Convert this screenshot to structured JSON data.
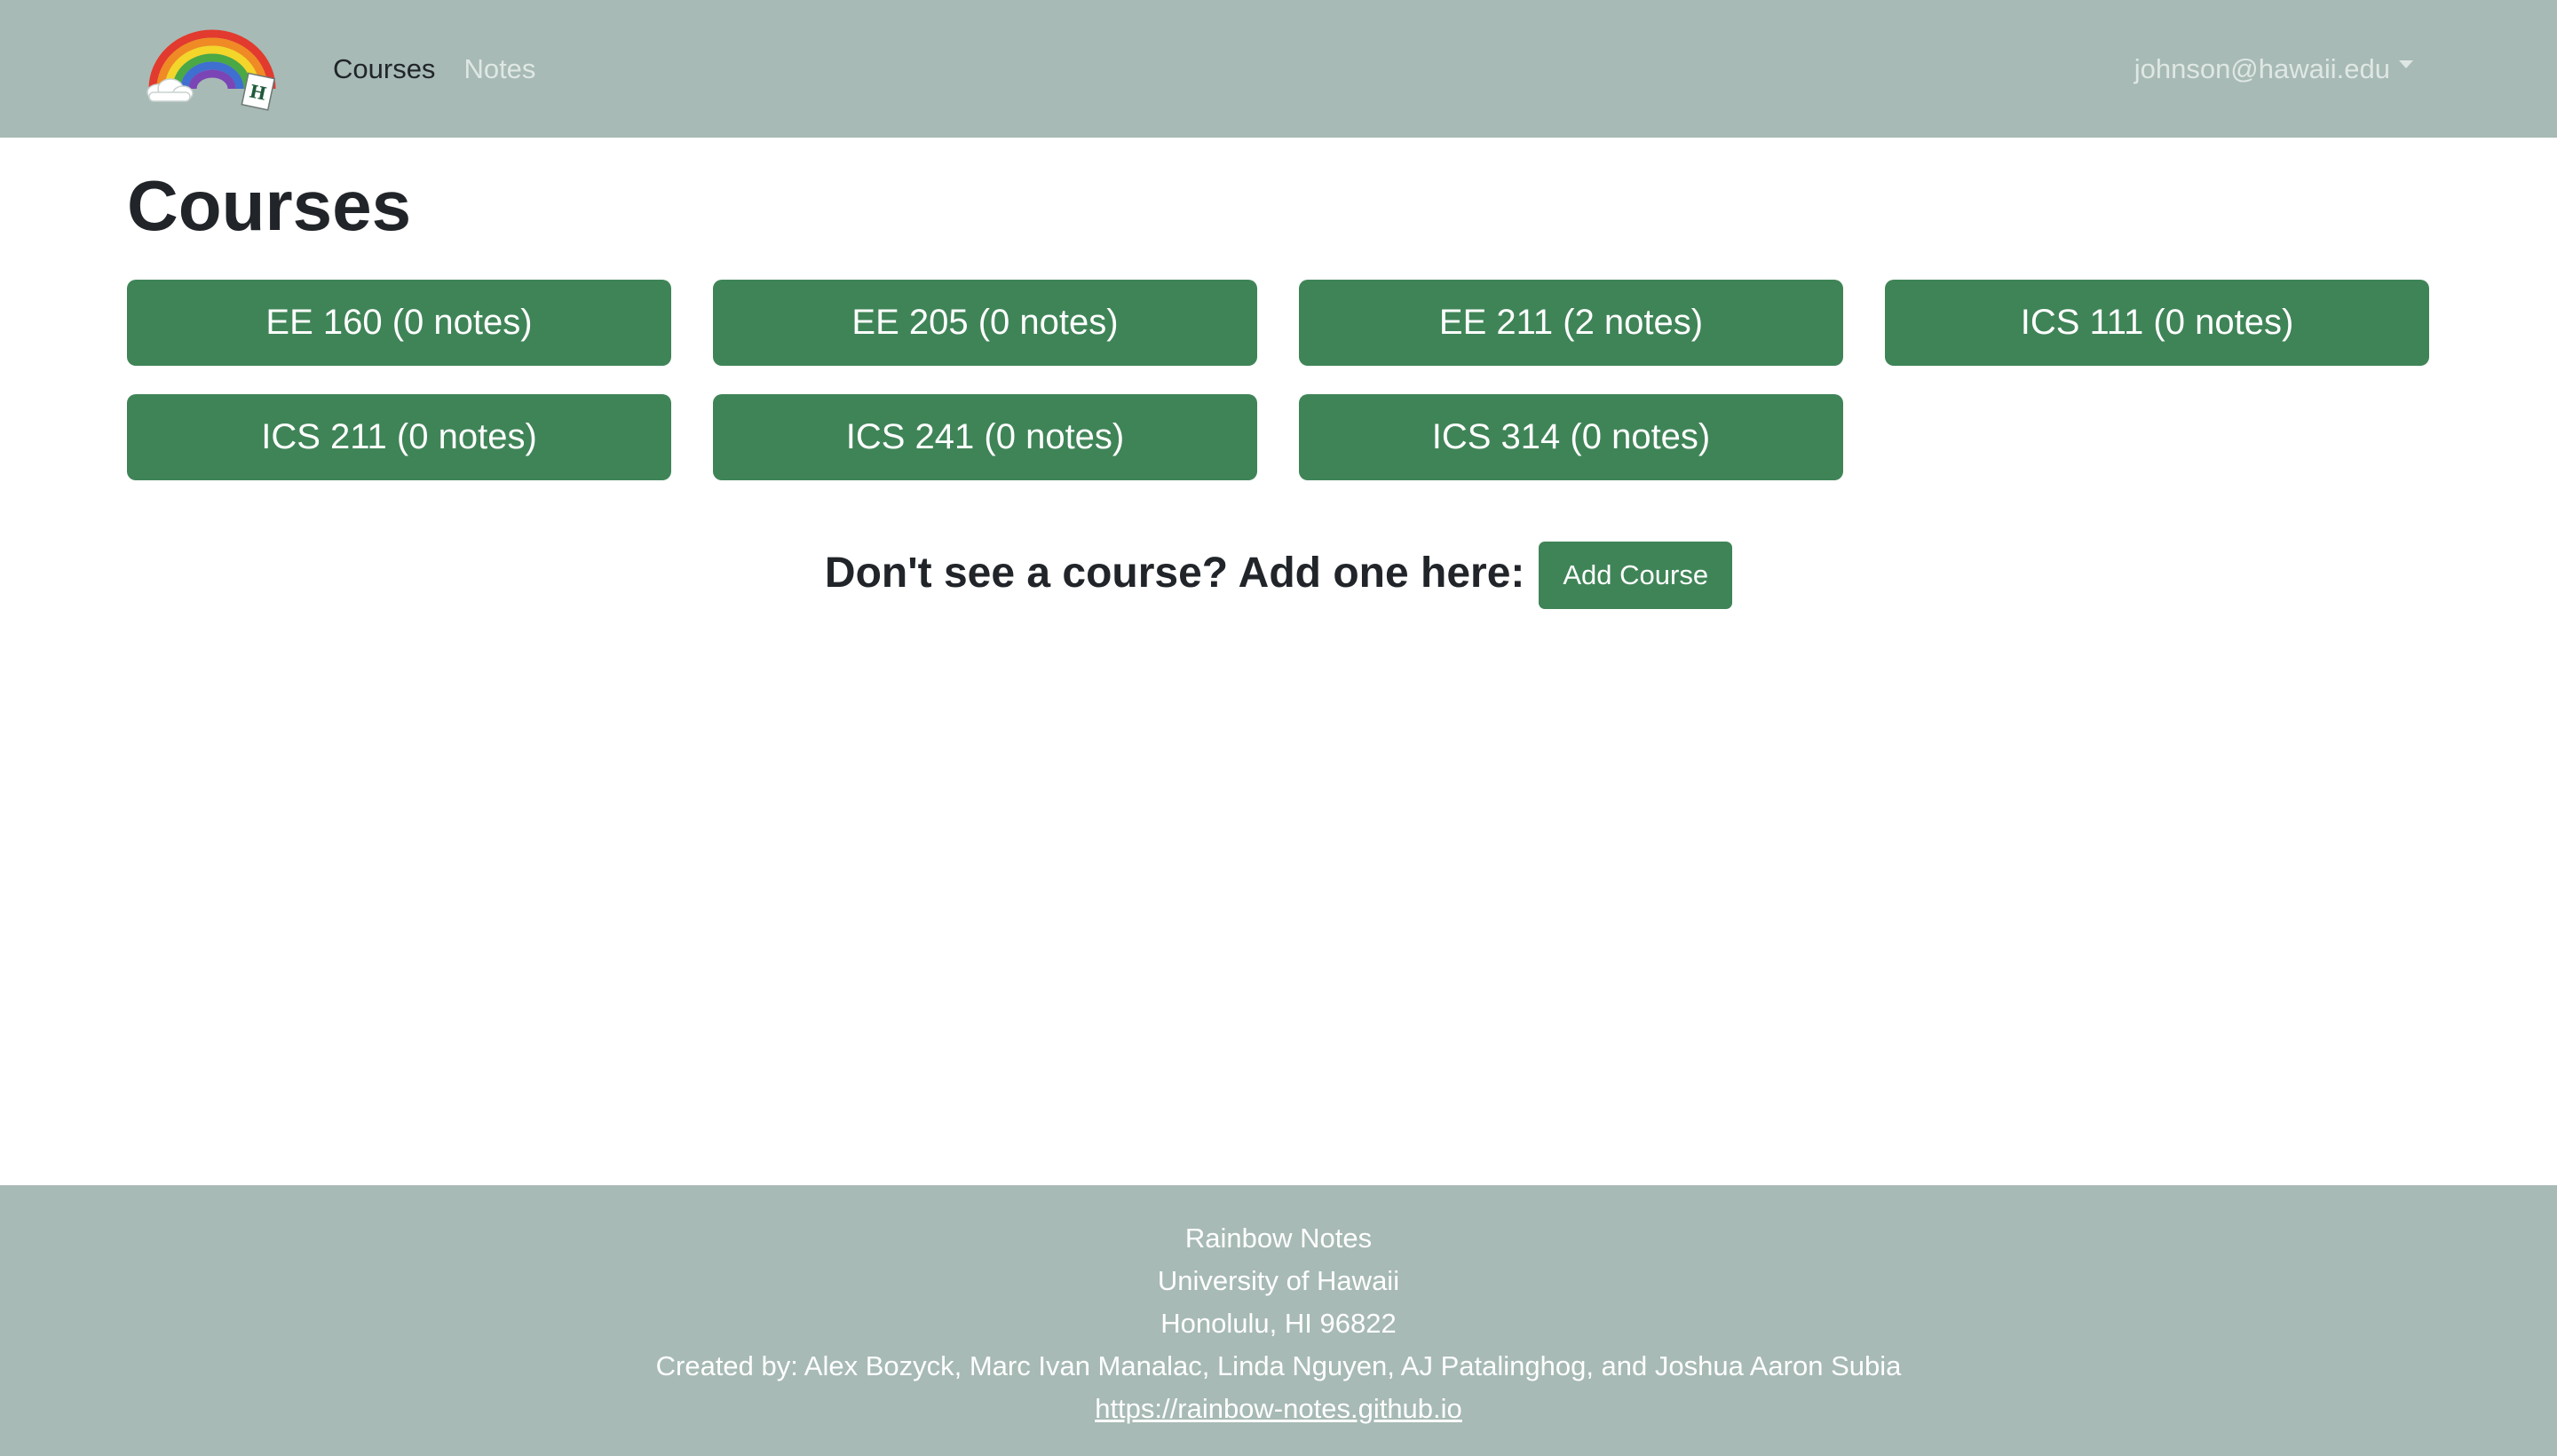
{
  "navbar": {
    "logo_icon": "rainbow-logo-icon",
    "links": [
      {
        "label": "Courses",
        "active": true
      },
      {
        "label": "Notes",
        "active": false
      }
    ],
    "user_email": "johnson@hawaii.edu",
    "user_dropdown_icon": "caret-down-icon",
    "background_color": "#a7bab5"
  },
  "main": {
    "title": "Courses",
    "courses": [
      {
        "label": "EE 160 (0 notes)"
      },
      {
        "label": "EE 205 (0 notes)"
      },
      {
        "label": "EE 211 (2 notes)"
      },
      {
        "label": "ICS 111 (0 notes)"
      },
      {
        "label": "ICS 211 (0 notes)"
      },
      {
        "label": "ICS 241 (0 notes)"
      },
      {
        "label": "ICS 314 (0 notes)"
      }
    ],
    "add_prompt": "Don't see a course? Add one here:",
    "add_button_label": "Add Course",
    "accent_color": "#3f8457"
  },
  "footer": {
    "lines": [
      "Rainbow Notes",
      "University of Hawaii",
      "Honolulu, HI 96822",
      "Created by: Alex Bozyck, Marc Ivan Manalac, Linda Nguyen, AJ Patalinghog, and Joshua Aaron Subia"
    ],
    "link": "https://rainbow-notes.github.io"
  }
}
